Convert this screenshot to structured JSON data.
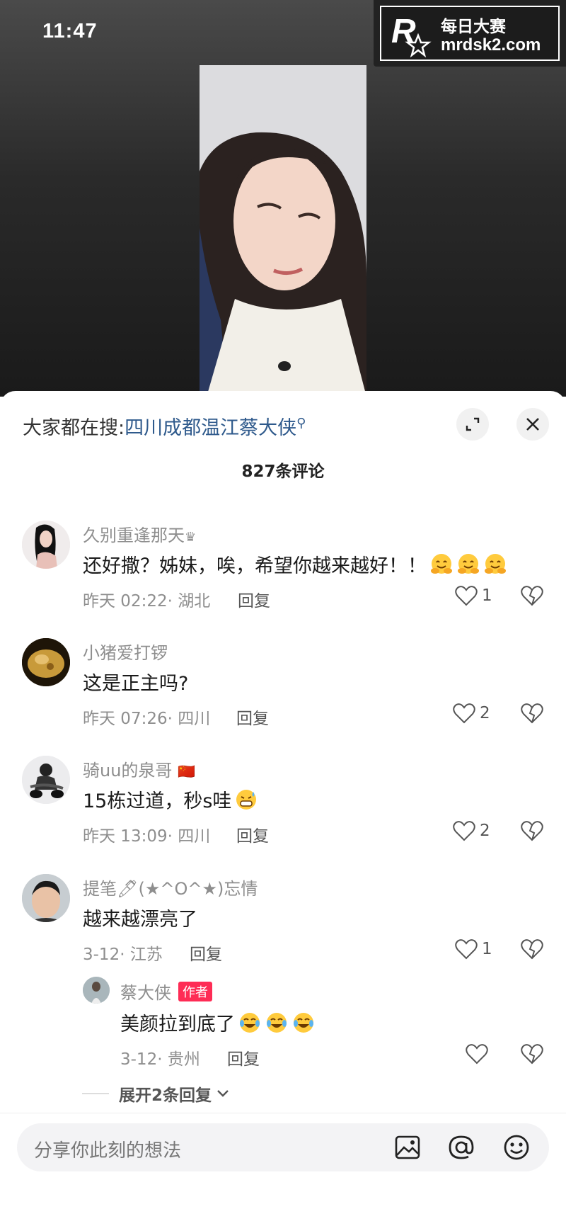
{
  "status_bar": {
    "time": "11:47"
  },
  "watermark": {
    "logo_text": "R",
    "line1": "每日大赛",
    "line2": "mrdsk2.com"
  },
  "panel": {
    "search_prefix": "大家都在搜:",
    "search_link": "四川成都温江蔡大侠",
    "comment_count": "827条评论"
  },
  "comments": [
    {
      "name": "久别重逢那天",
      "name_suffix": "♛",
      "text": "还好撒？姊妹，唉，希望你越来越好！！",
      "emojis": 3,
      "emoji_type": "hug-emoji",
      "time": "昨天 02:22",
      "location": "湖北",
      "reply_label": "回复",
      "likes": "1"
    },
    {
      "name": "小猪爱打锣",
      "text": "这是正主吗?",
      "time": "昨天 07:26",
      "location": "四川",
      "reply_label": "回复",
      "likes": "2"
    },
    {
      "name": "骑uu的泉哥",
      "name_suffix": "🇨🇳",
      "text": "15栋过道，秒s哇",
      "emojis": 1,
      "emoji_type": "grin-sweat-emoji",
      "time": "昨天 13:09",
      "location": "四川",
      "reply_label": "回复",
      "likes": "2"
    },
    {
      "name": "提笔🖊(★^O^★)忘情",
      "text": "越来越漂亮了",
      "time": "3-12",
      "location": "江苏",
      "reply_label": "回复",
      "likes": "1"
    }
  ],
  "reply": {
    "name": "蔡大侠",
    "badge": "作者",
    "text": "美颜拉到底了",
    "emojis": 3,
    "emoji_type": "laugh-cry-emoji",
    "time": "3-12",
    "location": "贵州",
    "reply_label": "回复",
    "likes": ""
  },
  "expand": {
    "label": "展开2条回复"
  },
  "input": {
    "placeholder": "分享你此刻的想法"
  },
  "colors": {
    "link": "#2f5a8c",
    "badge": "#fe2c55",
    "muted": "#8e8e8e"
  }
}
